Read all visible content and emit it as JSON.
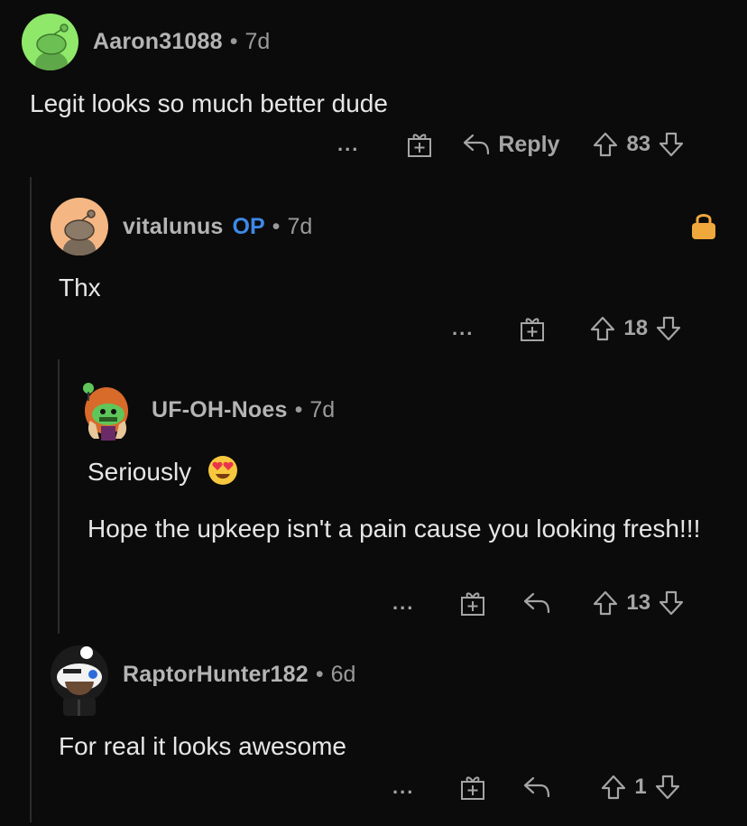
{
  "comments": [
    {
      "username": "Aaron31088",
      "age": "7d",
      "text": "Legit looks so much better dude",
      "more": "...",
      "reply_label": "Reply",
      "votes": "83"
    },
    {
      "username": "vitalunus",
      "op_badge": "OP",
      "age": "7d",
      "text": "Thx",
      "more": "...",
      "votes": "18",
      "lock_icon": "lock-icon"
    },
    {
      "username": "UF-OH-Noes",
      "age": "7d",
      "text_line1": "Seriously",
      "text_paragraph": "Hope the upkeep isn't a pain cause you looking fresh!!!",
      "emoji": "heart-eyes-emoji",
      "more": "...",
      "votes": "13"
    },
    {
      "username": "RaptorHunter182",
      "age": "6d",
      "text": "For real it looks awesome",
      "more": "...",
      "votes": "1"
    }
  ],
  "separator": "•",
  "colors": {
    "background": "#0b0b0b",
    "username": "#b4b4b4",
    "op": "#3d8ae8",
    "lock": "#f0a73c",
    "thread_line": "#2c2c2c"
  }
}
